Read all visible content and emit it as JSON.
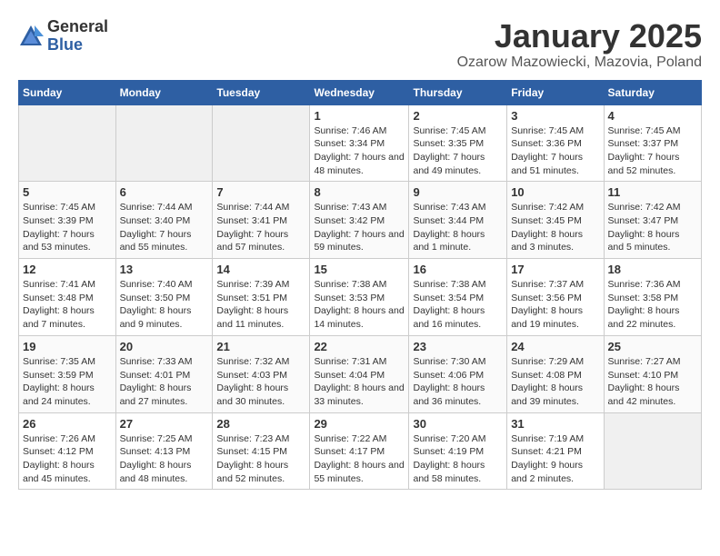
{
  "logo": {
    "general": "General",
    "blue": "Blue"
  },
  "title": "January 2025",
  "subtitle": "Ozarow Mazowiecki, Mazovia, Poland",
  "weekdays": [
    "Sunday",
    "Monday",
    "Tuesday",
    "Wednesday",
    "Thursday",
    "Friday",
    "Saturday"
  ],
  "weeks": [
    [
      {
        "day": "",
        "sunrise": "",
        "sunset": "",
        "daylight": ""
      },
      {
        "day": "",
        "sunrise": "",
        "sunset": "",
        "daylight": ""
      },
      {
        "day": "",
        "sunrise": "",
        "sunset": "",
        "daylight": ""
      },
      {
        "day": "1",
        "sunrise": "Sunrise: 7:46 AM",
        "sunset": "Sunset: 3:34 PM",
        "daylight": "Daylight: 7 hours and 48 minutes."
      },
      {
        "day": "2",
        "sunrise": "Sunrise: 7:45 AM",
        "sunset": "Sunset: 3:35 PM",
        "daylight": "Daylight: 7 hours and 49 minutes."
      },
      {
        "day": "3",
        "sunrise": "Sunrise: 7:45 AM",
        "sunset": "Sunset: 3:36 PM",
        "daylight": "Daylight: 7 hours and 51 minutes."
      },
      {
        "day": "4",
        "sunrise": "Sunrise: 7:45 AM",
        "sunset": "Sunset: 3:37 PM",
        "daylight": "Daylight: 7 hours and 52 minutes."
      }
    ],
    [
      {
        "day": "5",
        "sunrise": "Sunrise: 7:45 AM",
        "sunset": "Sunset: 3:39 PM",
        "daylight": "Daylight: 7 hours and 53 minutes."
      },
      {
        "day": "6",
        "sunrise": "Sunrise: 7:44 AM",
        "sunset": "Sunset: 3:40 PM",
        "daylight": "Daylight: 7 hours and 55 minutes."
      },
      {
        "day": "7",
        "sunrise": "Sunrise: 7:44 AM",
        "sunset": "Sunset: 3:41 PM",
        "daylight": "Daylight: 7 hours and 57 minutes."
      },
      {
        "day": "8",
        "sunrise": "Sunrise: 7:43 AM",
        "sunset": "Sunset: 3:42 PM",
        "daylight": "Daylight: 7 hours and 59 minutes."
      },
      {
        "day": "9",
        "sunrise": "Sunrise: 7:43 AM",
        "sunset": "Sunset: 3:44 PM",
        "daylight": "Daylight: 8 hours and 1 minute."
      },
      {
        "day": "10",
        "sunrise": "Sunrise: 7:42 AM",
        "sunset": "Sunset: 3:45 PM",
        "daylight": "Daylight: 8 hours and 3 minutes."
      },
      {
        "day": "11",
        "sunrise": "Sunrise: 7:42 AM",
        "sunset": "Sunset: 3:47 PM",
        "daylight": "Daylight: 8 hours and 5 minutes."
      }
    ],
    [
      {
        "day": "12",
        "sunrise": "Sunrise: 7:41 AM",
        "sunset": "Sunset: 3:48 PM",
        "daylight": "Daylight: 8 hours and 7 minutes."
      },
      {
        "day": "13",
        "sunrise": "Sunrise: 7:40 AM",
        "sunset": "Sunset: 3:50 PM",
        "daylight": "Daylight: 8 hours and 9 minutes."
      },
      {
        "day": "14",
        "sunrise": "Sunrise: 7:39 AM",
        "sunset": "Sunset: 3:51 PM",
        "daylight": "Daylight: 8 hours and 11 minutes."
      },
      {
        "day": "15",
        "sunrise": "Sunrise: 7:38 AM",
        "sunset": "Sunset: 3:53 PM",
        "daylight": "Daylight: 8 hours and 14 minutes."
      },
      {
        "day": "16",
        "sunrise": "Sunrise: 7:38 AM",
        "sunset": "Sunset: 3:54 PM",
        "daylight": "Daylight: 8 hours and 16 minutes."
      },
      {
        "day": "17",
        "sunrise": "Sunrise: 7:37 AM",
        "sunset": "Sunset: 3:56 PM",
        "daylight": "Daylight: 8 hours and 19 minutes."
      },
      {
        "day": "18",
        "sunrise": "Sunrise: 7:36 AM",
        "sunset": "Sunset: 3:58 PM",
        "daylight": "Daylight: 8 hours and 22 minutes."
      }
    ],
    [
      {
        "day": "19",
        "sunrise": "Sunrise: 7:35 AM",
        "sunset": "Sunset: 3:59 PM",
        "daylight": "Daylight: 8 hours and 24 minutes."
      },
      {
        "day": "20",
        "sunrise": "Sunrise: 7:33 AM",
        "sunset": "Sunset: 4:01 PM",
        "daylight": "Daylight: 8 hours and 27 minutes."
      },
      {
        "day": "21",
        "sunrise": "Sunrise: 7:32 AM",
        "sunset": "Sunset: 4:03 PM",
        "daylight": "Daylight: 8 hours and 30 minutes."
      },
      {
        "day": "22",
        "sunrise": "Sunrise: 7:31 AM",
        "sunset": "Sunset: 4:04 PM",
        "daylight": "Daylight: 8 hours and 33 minutes."
      },
      {
        "day": "23",
        "sunrise": "Sunrise: 7:30 AM",
        "sunset": "Sunset: 4:06 PM",
        "daylight": "Daylight: 8 hours and 36 minutes."
      },
      {
        "day": "24",
        "sunrise": "Sunrise: 7:29 AM",
        "sunset": "Sunset: 4:08 PM",
        "daylight": "Daylight: 8 hours and 39 minutes."
      },
      {
        "day": "25",
        "sunrise": "Sunrise: 7:27 AM",
        "sunset": "Sunset: 4:10 PM",
        "daylight": "Daylight: 8 hours and 42 minutes."
      }
    ],
    [
      {
        "day": "26",
        "sunrise": "Sunrise: 7:26 AM",
        "sunset": "Sunset: 4:12 PM",
        "daylight": "Daylight: 8 hours and 45 minutes."
      },
      {
        "day": "27",
        "sunrise": "Sunrise: 7:25 AM",
        "sunset": "Sunset: 4:13 PM",
        "daylight": "Daylight: 8 hours and 48 minutes."
      },
      {
        "day": "28",
        "sunrise": "Sunrise: 7:23 AM",
        "sunset": "Sunset: 4:15 PM",
        "daylight": "Daylight: 8 hours and 52 minutes."
      },
      {
        "day": "29",
        "sunrise": "Sunrise: 7:22 AM",
        "sunset": "Sunset: 4:17 PM",
        "daylight": "Daylight: 8 hours and 55 minutes."
      },
      {
        "day": "30",
        "sunrise": "Sunrise: 7:20 AM",
        "sunset": "Sunset: 4:19 PM",
        "daylight": "Daylight: 8 hours and 58 minutes."
      },
      {
        "day": "31",
        "sunrise": "Sunrise: 7:19 AM",
        "sunset": "Sunset: 4:21 PM",
        "daylight": "Daylight: 9 hours and 2 minutes."
      },
      {
        "day": "",
        "sunrise": "",
        "sunset": "",
        "daylight": ""
      }
    ]
  ]
}
